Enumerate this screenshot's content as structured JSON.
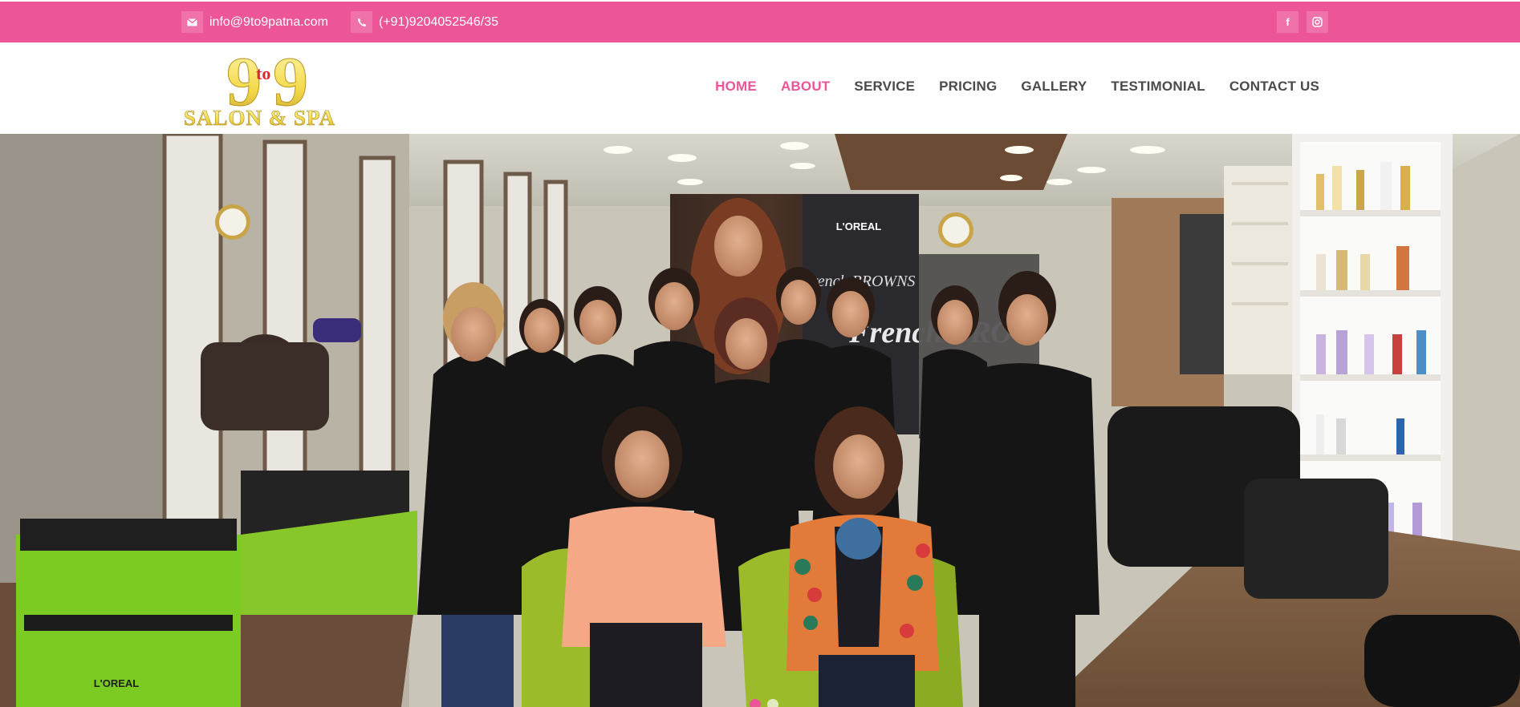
{
  "topbar": {
    "email": "info@9to9patna.com",
    "phone": "(+91)9204052546/35",
    "email_icon": "envelope-icon",
    "phone_icon": "phone-icon",
    "social": [
      {
        "name": "facebook-icon",
        "glyph": "f"
      },
      {
        "name": "instagram-icon",
        "glyph": "◎"
      }
    ]
  },
  "logo": {
    "top_text_1": "9",
    "top_text_mid": "to",
    "top_text_2": "9",
    "bottom_text": "SALON & SPA"
  },
  "nav": {
    "items": [
      {
        "label": "HOME",
        "active": true
      },
      {
        "label": "ABOUT",
        "active": true
      },
      {
        "label": "SERVICE",
        "active": false
      },
      {
        "label": "PRICING",
        "active": false
      },
      {
        "label": "GALLERY",
        "active": false
      },
      {
        "label": "TESTIMONIAL",
        "active": false
      },
      {
        "label": "CONTACT US",
        "active": false
      }
    ]
  },
  "hero": {
    "brand_poster_1": "L'OREAL",
    "brand_poster_2": "French BROWNS",
    "brand_poster_3": "French BRO",
    "shelf_brand": "L'OREAL",
    "trolley_brand": "L'OREAL"
  },
  "colors": {
    "accent": "#ec5598",
    "nav_text": "#4a4a4a",
    "logo_yellow": "#f5e06a",
    "logo_red": "#e0262b"
  }
}
